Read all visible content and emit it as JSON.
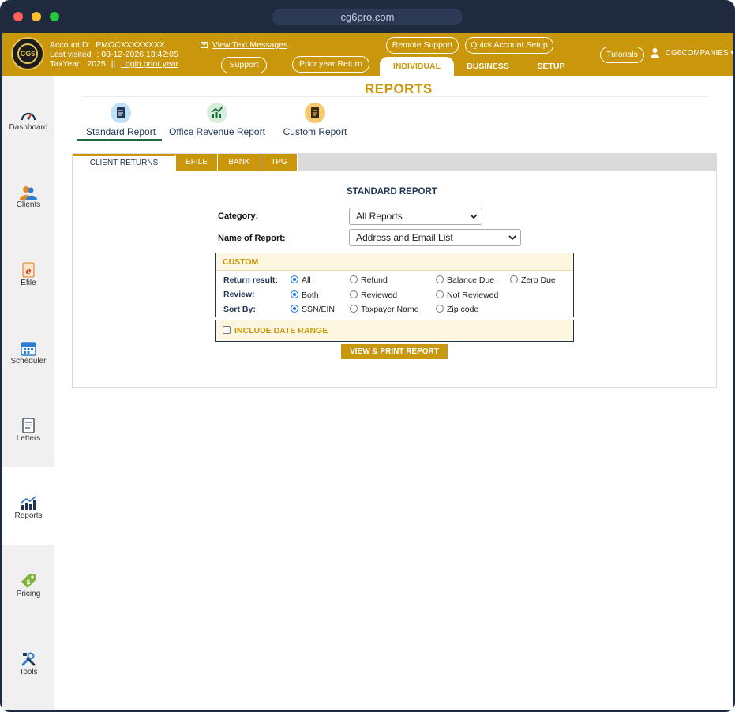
{
  "browser": {
    "url": "cg6pro.com",
    "dot_colors": [
      "#ff5f57",
      "#febc2e",
      "#28c840"
    ]
  },
  "header": {
    "brand_color": "#c9960c",
    "logo_text": "CG6",
    "account_id_label": "AccountID:",
    "account_id_value": "PMOCXXXXXXXX",
    "last_visited_label": "Last visited",
    "last_visited_value": ": 08-12-2026 13:42:05",
    "tax_year_label": "TaxYear:",
    "tax_year_value": "2025",
    "separator": "||",
    "login_prior_year": "Login prior year",
    "view_text_messages": "View Text Messages",
    "buttons": {
      "remote_support": "Remote Support",
      "quick_account_setup": "Quick Account Setup",
      "support": "Support",
      "prior_year_return": "Prior year Return",
      "tutorials": "Tutorials"
    },
    "tabs": {
      "individual": "INDIVIDUAL",
      "business": "BUSINESS",
      "setup": "SETUP"
    },
    "user_name": "CG6COMPANIES",
    "user_caret": "▾"
  },
  "sidebar": {
    "items": [
      {
        "label": "Dashboard",
        "icon": "gauge-icon"
      },
      {
        "label": "Clients",
        "icon": "users-icon"
      },
      {
        "label": "Efile",
        "icon": "efile-icon"
      },
      {
        "label": "Scheduler",
        "icon": "calendar-icon"
      },
      {
        "label": "Letters",
        "icon": "letter-icon"
      },
      {
        "label": "Reports",
        "icon": "chart-icon"
      },
      {
        "label": "Pricing",
        "icon": "price-tag-icon"
      },
      {
        "label": "Tools",
        "icon": "tools-icon"
      }
    ],
    "active": "Reports"
  },
  "main": {
    "title": "REPORTS",
    "report_types": [
      {
        "label": "Standard Report",
        "icon": "standard-report-icon"
      },
      {
        "label": "Office Revenue Report",
        "icon": "revenue-chart-icon"
      },
      {
        "label": "Custom Report",
        "icon": "custom-report-icon"
      }
    ],
    "active_report_type": "Standard Report",
    "tabs": [
      "CLIENT RETURNS",
      "EFILE",
      "BANK",
      "TPG"
    ],
    "active_tab": "CLIENT RETURNS",
    "section_title": "STANDARD REPORT",
    "category_label": "Category:",
    "category_value": "All Reports",
    "report_name_label": "Name of Report:",
    "report_name_value": "Address and Email List",
    "custom": {
      "title": "CUSTOM",
      "return_result_label": "Return result:",
      "return_result_options": [
        "All",
        "Refund",
        "Balance Due",
        "Zero Due"
      ],
      "return_result_selected": "All",
      "review_label": "Review:",
      "review_options": [
        "Both",
        "Reviewed",
        "Not Reviewed"
      ],
      "review_selected": "Both",
      "sort_label": "Sort By:",
      "sort_options": [
        "SSN/EIN",
        "Taxpayer Name",
        "Zip code"
      ],
      "sort_selected": "SSN/EIN"
    },
    "include_date_range": "INCLUDE DATE RANGE",
    "include_date_range_checked": false,
    "print_button": "VIEW & PRINT REPORT"
  }
}
